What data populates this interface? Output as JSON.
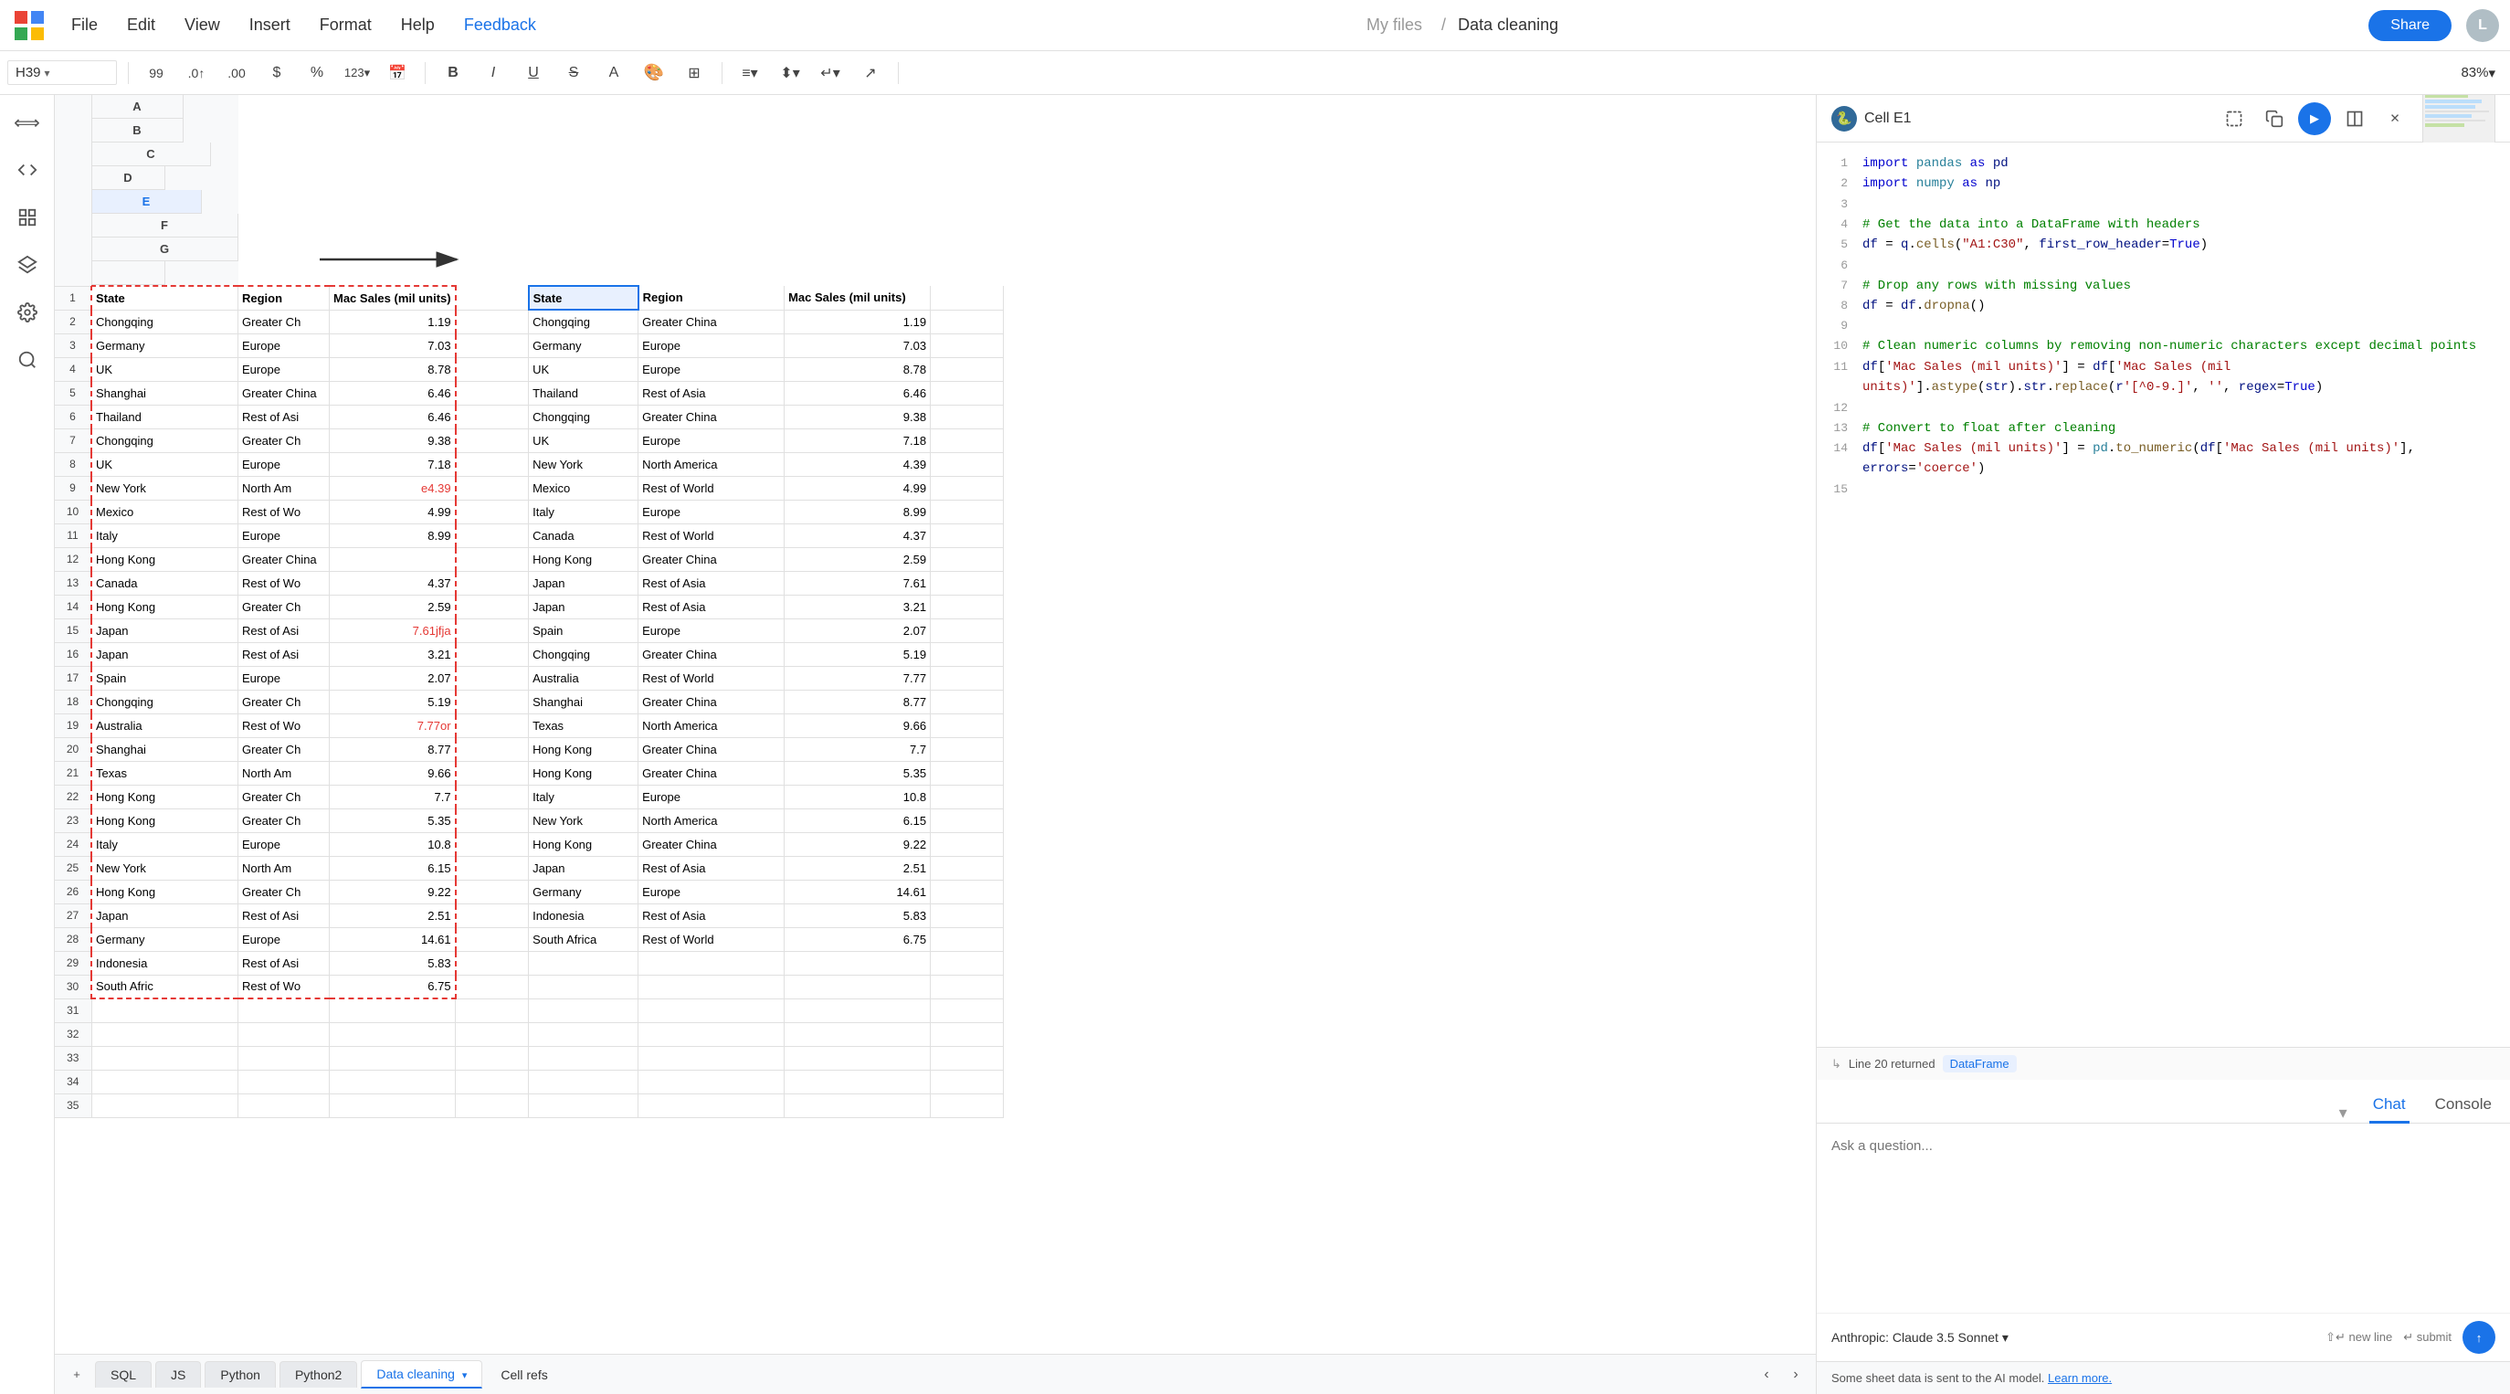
{
  "app": {
    "title": "Data cleaning",
    "breadcrumb_separator": "/",
    "breadcrumb_parent": "My files",
    "share_label": "Share",
    "user_initial": "L"
  },
  "menu": {
    "items": [
      "File",
      "Edit",
      "View",
      "Insert",
      "Format",
      "Help",
      "Feedback"
    ]
  },
  "formula_bar": {
    "cell_ref": "H39",
    "zoom": "83%"
  },
  "columns": {
    "left": [
      "A",
      "B",
      "C",
      "D"
    ],
    "right": [
      "E",
      "F",
      "G"
    ]
  },
  "rows": [
    {
      "row": 1,
      "a": "State",
      "b": "Region",
      "c": "Mac Sales (mil units)",
      "d": "",
      "e": "State",
      "f": "Region",
      "g": "Mac Sales (mil units)"
    },
    {
      "row": 2,
      "a": "Chongqing",
      "b": "Greater Ch",
      "c": "1.19",
      "d": "",
      "e": "Chongqing",
      "f": "Greater China",
      "g": "1.19"
    },
    {
      "row": 3,
      "a": "Germany",
      "b": "Europe",
      "c": "7.03",
      "d": "",
      "e": "Germany",
      "f": "Europe",
      "g": "7.03"
    },
    {
      "row": 4,
      "a": "UK",
      "b": "Europe",
      "c": "8.78",
      "d": "",
      "e": "UK",
      "f": "Europe",
      "g": "8.78"
    },
    {
      "row": 5,
      "a": "Shanghai",
      "b": "Greater China",
      "c": "6.46",
      "d": "",
      "e": "Thailand",
      "f": "Rest of Asia",
      "g": "6.46"
    },
    {
      "row": 6,
      "a": "Thailand",
      "b": "Rest of Asi",
      "c": "6.46",
      "d": "",
      "e": "Chongqing",
      "f": "Greater China",
      "g": "9.38"
    },
    {
      "row": 7,
      "a": "Chongqing",
      "b": "Greater Ch",
      "c": "9.38",
      "d": "",
      "e": "UK",
      "f": "Europe",
      "g": "7.18"
    },
    {
      "row": 8,
      "a": "UK",
      "b": "Europe",
      "c": "7.18",
      "d": "",
      "e": "New York",
      "f": "North America",
      "g": "4.39"
    },
    {
      "row": 9,
      "a": "New York",
      "b": "North Am",
      "c": "e4.39",
      "d": "",
      "e": "Mexico",
      "f": "Rest of World",
      "g": "4.99"
    },
    {
      "row": 10,
      "a": "Mexico",
      "b": "Rest of Wo",
      "c": "4.99",
      "d": "",
      "e": "Italy",
      "f": "Europe",
      "g": "8.99"
    },
    {
      "row": 11,
      "a": "Italy",
      "b": "Europe",
      "c": "8.99",
      "d": "",
      "e": "Canada",
      "f": "Rest of World",
      "g": "4.37"
    },
    {
      "row": 12,
      "a": "Hong Kong",
      "b": "Greater China",
      "c": "",
      "d": "",
      "e": "Hong Kong",
      "f": "Greater China",
      "g": "2.59"
    },
    {
      "row": 13,
      "a": "Canada",
      "b": "Rest of Wo",
      "c": "4.37",
      "d": "",
      "e": "Japan",
      "f": "Rest of Asia",
      "g": "7.61"
    },
    {
      "row": 14,
      "a": "Hong Kong",
      "b": "Greater Ch",
      "c": "2.59",
      "d": "",
      "e": "Japan",
      "f": "Rest of Asia",
      "g": "3.21"
    },
    {
      "row": 15,
      "a": "Japan",
      "b": "Rest of Asi",
      "c": "7.61jfja",
      "d": "",
      "e": "Spain",
      "f": "Europe",
      "g": "2.07"
    },
    {
      "row": 16,
      "a": "Japan",
      "b": "Rest of Asi",
      "c": "3.21",
      "d": "",
      "e": "Chongqing",
      "f": "Greater China",
      "g": "5.19"
    },
    {
      "row": 17,
      "a": "Spain",
      "b": "Europe",
      "c": "2.07",
      "d": "",
      "e": "Australia",
      "f": "Rest of World",
      "g": "7.77"
    },
    {
      "row": 18,
      "a": "Chongqing",
      "b": "Greater Ch",
      "c": "5.19",
      "d": "",
      "e": "Shanghai",
      "f": "Greater China",
      "g": "8.77"
    },
    {
      "row": 19,
      "a": "Australia",
      "b": "Rest of Wo",
      "c": "7.77or",
      "d": "",
      "e": "Texas",
      "f": "North America",
      "g": "9.66"
    },
    {
      "row": 20,
      "a": "Shanghai",
      "b": "Greater Ch",
      "c": "8.77",
      "d": "",
      "e": "Hong Kong",
      "f": "Greater China",
      "g": "7.7"
    },
    {
      "row": 21,
      "a": "Texas",
      "b": "North Am",
      "c": "9.66",
      "d": "",
      "e": "Hong Kong",
      "f": "Greater China",
      "g": "5.35"
    },
    {
      "row": 22,
      "a": "Hong Kong",
      "b": "Greater Ch",
      "c": "7.7",
      "d": "",
      "e": "Italy",
      "f": "Europe",
      "g": "10.8"
    },
    {
      "row": 23,
      "a": "Hong Kong",
      "b": "Greater Ch",
      "c": "5.35",
      "d": "",
      "e": "New York",
      "f": "North America",
      "g": "6.15"
    },
    {
      "row": 24,
      "a": "Italy",
      "b": "Europe",
      "c": "10.8",
      "d": "",
      "e": "Hong Kong",
      "f": "Greater China",
      "g": "9.22"
    },
    {
      "row": 25,
      "a": "New York",
      "b": "North Am",
      "c": "6.15",
      "d": "",
      "e": "Japan",
      "f": "Rest of Asia",
      "g": "2.51"
    },
    {
      "row": 26,
      "a": "Hong Kong",
      "b": "Greater Ch",
      "c": "9.22",
      "d": "",
      "e": "Germany",
      "f": "Europe",
      "g": "14.61"
    },
    {
      "row": 27,
      "a": "Japan",
      "b": "Rest of Asi",
      "c": "2.51",
      "d": "",
      "e": "Indonesia",
      "f": "Rest of Asia",
      "g": "5.83"
    },
    {
      "row": 28,
      "a": "Germany",
      "b": "Europe",
      "c": "14.61",
      "d": "",
      "e": "South Africa",
      "f": "Rest of World",
      "g": "6.75"
    },
    {
      "row": 29,
      "a": "Indonesia",
      "b": "Rest of Asi",
      "c": "5.83",
      "d": "",
      "e": "",
      "f": "",
      "g": ""
    },
    {
      "row": 30,
      "a": "South Afric",
      "b": "Rest of Wo",
      "c": "6.75",
      "d": "",
      "e": "",
      "f": "",
      "g": ""
    },
    {
      "row": 31,
      "a": "",
      "b": "",
      "c": "",
      "d": "",
      "e": "",
      "f": "",
      "g": ""
    },
    {
      "row": 32,
      "a": "",
      "b": "",
      "c": "",
      "d": "",
      "e": "",
      "f": "",
      "g": ""
    },
    {
      "row": 33,
      "a": "",
      "b": "",
      "c": "",
      "d": "",
      "e": "",
      "f": "",
      "g": ""
    },
    {
      "row": 34,
      "a": "",
      "b": "",
      "c": "",
      "d": "",
      "e": "",
      "f": "",
      "g": ""
    },
    {
      "row": 35,
      "a": "",
      "b": "",
      "c": "",
      "d": "",
      "e": "",
      "f": "",
      "g": ""
    }
  ],
  "code_panel": {
    "title": "Cell E1",
    "lines": [
      {
        "num": 1,
        "content": "import pandas as pd"
      },
      {
        "num": 2,
        "content": "import numpy as np"
      },
      {
        "num": 3,
        "content": ""
      },
      {
        "num": 4,
        "content": "# Get the data into a DataFrame with headers"
      },
      {
        "num": 5,
        "content": "df = q.cells(\"A1:C30\", first_row_header=True)"
      },
      {
        "num": 6,
        "content": ""
      },
      {
        "num": 7,
        "content": "# Drop any rows with missing values"
      },
      {
        "num": 8,
        "content": "df = df.dropna()"
      },
      {
        "num": 9,
        "content": ""
      },
      {
        "num": 10,
        "content": "# Clean numeric columns by removing non-numeric characters except decimal points"
      },
      {
        "num": 11,
        "content": "df['Mac Sales (mil units)'] = df['Mac Sales (mil units)'].astype(str).str.replace(r'[^0-9.]', '', regex=True)"
      },
      {
        "num": 12,
        "content": ""
      },
      {
        "num": 13,
        "content": "# Convert to float after cleaning"
      },
      {
        "num": 14,
        "content": "df['Mac Sales (mil units)'] = pd.to_numeric(df['Mac Sales (mil units)'], errors='coerce')"
      },
      {
        "num": 15,
        "content": ""
      }
    ],
    "output": "Line 20 returned",
    "output_badge": "DataFrame"
  },
  "chat": {
    "tab_chat": "Chat",
    "tab_console": "Console",
    "placeholder": "Ask a question...",
    "model_label": "Anthropic: Claude 3.5 Sonnet",
    "new_line_hint": "⇧↵ new line",
    "submit_hint": "↵ submit",
    "status_text": "Some sheet data is sent to the AI model.",
    "learn_more": "Learn more."
  },
  "sheets": {
    "tabs": [
      "SQL",
      "JS",
      "Python",
      "Python2",
      "Data cleaning",
      "Cell refs"
    ],
    "active": "Data cleaning"
  },
  "sidebar_icons": [
    "grid",
    "code",
    "layers",
    "settings",
    "search"
  ]
}
